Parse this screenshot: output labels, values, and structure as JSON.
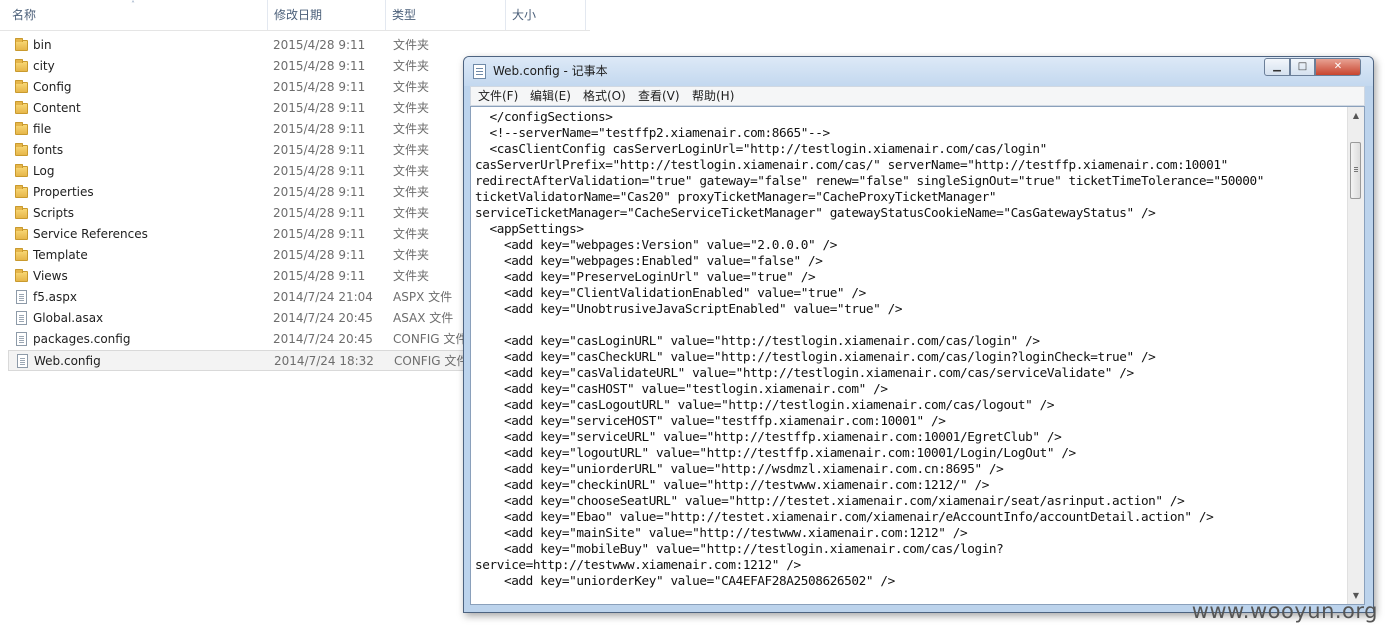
{
  "explorer": {
    "columns": {
      "name": "名称",
      "date": "修改日期",
      "type": "类型",
      "size": "大小"
    },
    "sort_arrow": "˄",
    "files": [
      {
        "name": "bin",
        "date": "2015/4/28 9:11",
        "type": "文件夹",
        "kind": "folder"
      },
      {
        "name": "city",
        "date": "2015/4/28 9:11",
        "type": "文件夹",
        "kind": "folder"
      },
      {
        "name": "Config",
        "date": "2015/4/28 9:11",
        "type": "文件夹",
        "kind": "folder"
      },
      {
        "name": "Content",
        "date": "2015/4/28 9:11",
        "type": "文件夹",
        "kind": "folder"
      },
      {
        "name": "file",
        "date": "2015/4/28 9:11",
        "type": "文件夹",
        "kind": "folder"
      },
      {
        "name": "fonts",
        "date": "2015/4/28 9:11",
        "type": "文件夹",
        "kind": "folder"
      },
      {
        "name": "Log",
        "date": "2015/4/28 9:11",
        "type": "文件夹",
        "kind": "folder"
      },
      {
        "name": "Properties",
        "date": "2015/4/28 9:11",
        "type": "文件夹",
        "kind": "folder"
      },
      {
        "name": "Scripts",
        "date": "2015/4/28 9:11",
        "type": "文件夹",
        "kind": "folder"
      },
      {
        "name": "Service References",
        "date": "2015/4/28 9:11",
        "type": "文件夹",
        "kind": "folder"
      },
      {
        "name": "Template",
        "date": "2015/4/28 9:11",
        "type": "文件夹",
        "kind": "folder"
      },
      {
        "name": "Views",
        "date": "2015/4/28 9:11",
        "type": "文件夹",
        "kind": "folder"
      },
      {
        "name": "f5.aspx",
        "date": "2014/7/24 21:04",
        "type": "ASPX 文件",
        "kind": "file"
      },
      {
        "name": "Global.asax",
        "date": "2014/7/24 20:45",
        "type": "ASAX 文件",
        "kind": "file"
      },
      {
        "name": "packages.config",
        "date": "2014/7/24 20:45",
        "type": "CONFIG 文件",
        "kind": "file"
      },
      {
        "name": "Web.config",
        "date": "2014/7/24 18:32",
        "type": "CONFIG 文件",
        "kind": "file",
        "selected": true
      }
    ]
  },
  "notepad": {
    "title": "Web.config - 记事本",
    "buttons": {
      "minimize": "▁",
      "maximize": "□",
      "close": "✕"
    },
    "menu": [
      "文件(F)",
      "编辑(E)",
      "格式(O)",
      "查看(V)",
      "帮助(H)"
    ],
    "scroll_up": "▲",
    "scroll_down": "▼",
    "lines": [
      "  </configSections>",
      "  <!--serverName=\"testffp2.xiamenair.com:8665\"-->",
      "  <casClientConfig casServerLoginUrl=\"http://testlogin.xiamenair.com/cas/login\"",
      "casServerUrlPrefix=\"http://testlogin.xiamenair.com/cas/\" serverName=\"http://testffp.xiamenair.com:10001\"",
      "redirectAfterValidation=\"true\" gateway=\"false\" renew=\"false\" singleSignOut=\"true\" ticketTimeTolerance=\"50000\"",
      "ticketValidatorName=\"Cas20\" proxyTicketManager=\"CacheProxyTicketManager\"",
      "serviceTicketManager=\"CacheServiceTicketManager\" gatewayStatusCookieName=\"CasGatewayStatus\" />",
      "  <appSettings>",
      "    <add key=\"webpages:Version\" value=\"2.0.0.0\" />",
      "    <add key=\"webpages:Enabled\" value=\"false\" />",
      "    <add key=\"PreserveLoginUrl\" value=\"true\" />",
      "    <add key=\"ClientValidationEnabled\" value=\"true\" />",
      "    <add key=\"UnobtrusiveJavaScriptEnabled\" value=\"true\" />",
      "",
      "    <add key=\"casLoginURL\" value=\"http://testlogin.xiamenair.com/cas/login\" />",
      "    <add key=\"casCheckURL\" value=\"http://testlogin.xiamenair.com/cas/login?loginCheck=true\" />",
      "    <add key=\"casValidateURL\" value=\"http://testlogin.xiamenair.com/cas/serviceValidate\" />",
      "    <add key=\"casHOST\" value=\"testlogin.xiamenair.com\" />",
      "    <add key=\"casLogoutURL\" value=\"http://testlogin.xiamenair.com/cas/logout\" />",
      "    <add key=\"serviceHOST\" value=\"testffp.xiamenair.com:10001\" />",
      "    <add key=\"serviceURL\" value=\"http://testffp.xiamenair.com:10001/EgretClub\" />",
      "    <add key=\"logoutURL\" value=\"http://testffp.xiamenair.com:10001/Login/LogOut\" />",
      "    <add key=\"uniorderURL\" value=\"http://wsdmzl.xiamenair.com.cn:8695\" />",
      "    <add key=\"checkinURL\" value=\"http://testwww.xiamenair.com:1212/\" />",
      "    <add key=\"chooseSeatURL\" value=\"http://testet.xiamenair.com/xiamenair/seat/asrinput.action\" />",
      "    <add key=\"Ebao\" value=\"http://testet.xiamenair.com/xiamenair/eAccountInfo/accountDetail.action\" />",
      "    <add key=\"mainSite\" value=\"http://testwww.xiamenair.com:1212\" />",
      "    <add key=\"mobileBuy\" value=\"http://testlogin.xiamenair.com/cas/login?",
      "service=http://testwww.xiamenair.com:1212\" />",
      "    <add key=\"uniorderKey\" value=\"CA4EFAF28A2508626502\" />"
    ]
  },
  "watermark": "www.wooyun.org"
}
